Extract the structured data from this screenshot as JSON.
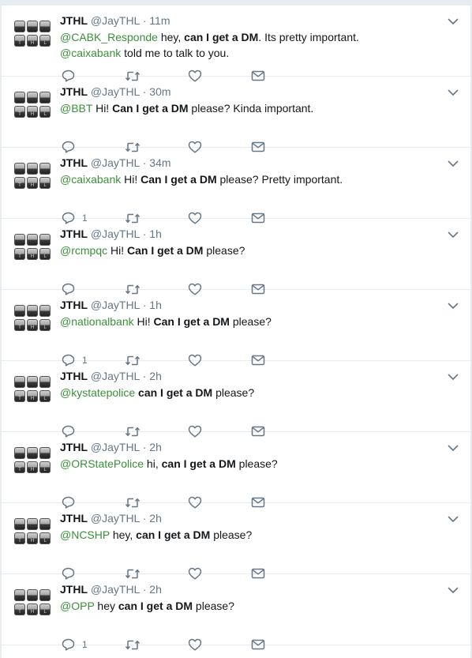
{
  "tweets": [
    {
      "name": "JTHL",
      "handle": "@JayTHL",
      "sep": "·",
      "time": "11m",
      "line1": [
        {
          "t": "@CABK_Responde",
          "k": "m"
        },
        {
          "t": " hey, ",
          "k": "n"
        },
        {
          "t": "can I get a DM",
          "k": "b"
        },
        {
          "t": ". Its pretty important.",
          "k": "n"
        }
      ],
      "line2": [
        {
          "t": "@caixabank",
          "k": "m"
        },
        {
          "t": " told me to talk to you.",
          "k": "n"
        }
      ],
      "reply_count": ""
    },
    {
      "name": "JTHL",
      "handle": "@JayTHL",
      "sep": "·",
      "time": "30m",
      "line1": [
        {
          "t": "@BBT",
          "k": "m"
        },
        {
          "t": " Hi! ",
          "k": "n"
        },
        {
          "t": "Can I get a DM",
          "k": "b"
        },
        {
          "t": " please? Kinda important.",
          "k": "n"
        }
      ],
      "reply_count": ""
    },
    {
      "name": "JTHL",
      "handle": "@JayTHL",
      "sep": "·",
      "time": "34m",
      "line1": [
        {
          "t": "@caixabank",
          "k": "m"
        },
        {
          "t": " Hi! ",
          "k": "n"
        },
        {
          "t": "Can I get a DM",
          "k": "b"
        },
        {
          "t": " please? Pretty important.",
          "k": "n"
        }
      ],
      "reply_count": "1"
    },
    {
      "name": "JTHL",
      "handle": "@JayTHL",
      "sep": "·",
      "time": "1h",
      "line1": [
        {
          "t": "@rcmpqc",
          "k": "m"
        },
        {
          "t": " Hi! ",
          "k": "n"
        },
        {
          "t": "Can I get a DM",
          "k": "b"
        },
        {
          "t": " please?",
          "k": "n"
        }
      ],
      "reply_count": ""
    },
    {
      "name": "JTHL",
      "handle": "@JayTHL",
      "sep": "·",
      "time": "1h",
      "line1": [
        {
          "t": "@nationalbank",
          "k": "m"
        },
        {
          "t": " Hi! ",
          "k": "n"
        },
        {
          "t": "Can I get a DM",
          "k": "b"
        },
        {
          "t": " please?",
          "k": "n"
        }
      ],
      "reply_count": "1"
    },
    {
      "name": "JTHL",
      "handle": "@JayTHL",
      "sep": "·",
      "time": "2h",
      "line1": [
        {
          "t": "@kystatepolice",
          "k": "m"
        },
        {
          "t": " ",
          "k": "n"
        },
        {
          "t": "can I get a DM",
          "k": "b"
        },
        {
          "t": " please?",
          "k": "n"
        }
      ],
      "reply_count": ""
    },
    {
      "name": "JTHL",
      "handle": "@JayTHL",
      "sep": "·",
      "time": "2h",
      "line1": [
        {
          "t": "@ORStatePolice",
          "k": "m"
        },
        {
          "t": " hi, ",
          "k": "n"
        },
        {
          "t": "can I get a DM",
          "k": "b"
        },
        {
          "t": " please?",
          "k": "n"
        }
      ],
      "reply_count": ""
    },
    {
      "name": "JTHL",
      "handle": "@JayTHL",
      "sep": "·",
      "time": "2h",
      "line1": [
        {
          "t": "@NCSHP",
          "k": "m"
        },
        {
          "t": " hey, ",
          "k": "n"
        },
        {
          "t": "can I get a DM",
          "k": "b"
        },
        {
          "t": " please?",
          "k": "n"
        }
      ],
      "reply_count": ""
    },
    {
      "name": "JTHL",
      "handle": "@JayTHL",
      "sep": "·",
      "time": "2h",
      "line1": [
        {
          "t": "@OPP",
          "k": "m"
        },
        {
          "t": " hey ",
          "k": "n"
        },
        {
          "t": "can I get a DM",
          "k": "b"
        },
        {
          "t": " please?",
          "k": "n"
        }
      ],
      "reply_count": "1"
    }
  ],
  "avatar_keys": [
    "",
    "",
    "",
    "T",
    "H",
    "L"
  ],
  "icons": {
    "reply": "reply-icon",
    "retweet": "retweet-icon",
    "like": "heart-icon",
    "dm": "envelope-icon",
    "menu": "chevron-down-icon"
  },
  "colors": {
    "mention": "#3b8f3b",
    "text": "#14171a",
    "muted": "#657786",
    "divider": "#e6ecf0"
  }
}
